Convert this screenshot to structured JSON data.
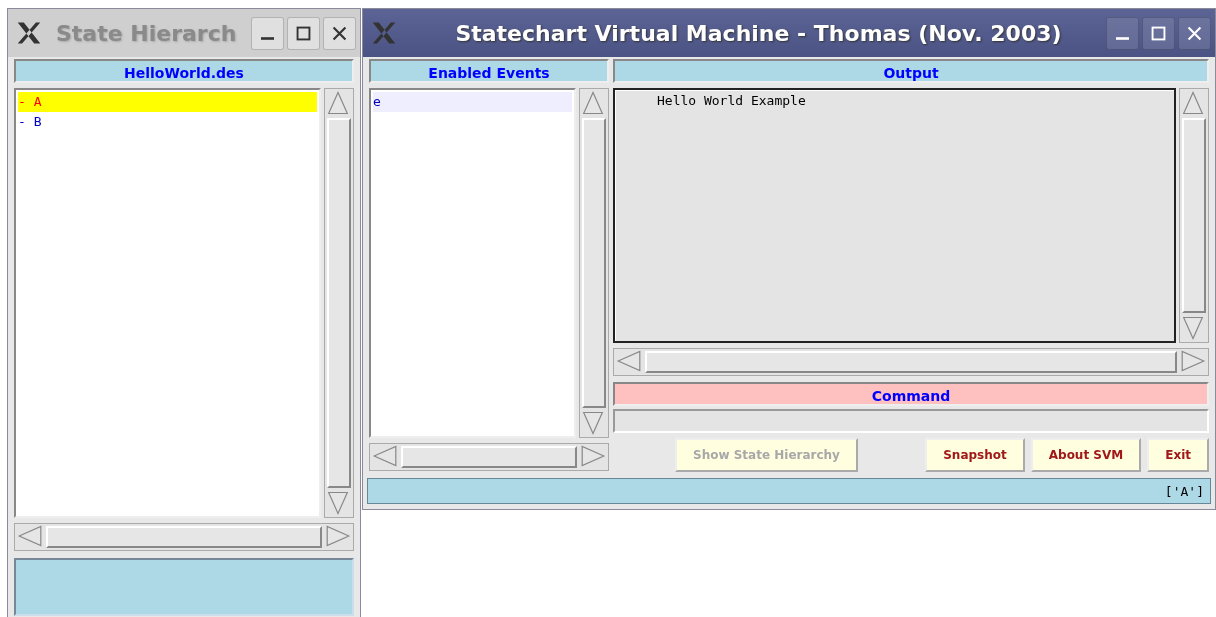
{
  "state_window": {
    "title": "State Hierarch",
    "active": false,
    "header": "HelloWorld.des",
    "states": [
      {
        "marker": "-",
        "name": "A",
        "selected": true
      },
      {
        "marker": "-",
        "name": "B",
        "selected": false
      }
    ]
  },
  "main_window": {
    "title": "Statechart Virtual Machine - Thomas (Nov. 2003)",
    "active": true,
    "events_header": "Enabled Events",
    "events": [
      {
        "name": "e",
        "selected": true
      }
    ],
    "output_header": "Output",
    "output_lines": [
      "Hello World Example"
    ],
    "command_header": "Command",
    "buttons": [
      {
        "label": "Show State Hierarchy",
        "disabled": true
      },
      {
        "label": "Snapshot",
        "disabled": false
      },
      {
        "label": "About SVM",
        "disabled": false
      },
      {
        "label": "Exit",
        "disabled": false
      }
    ],
    "status": "['A']"
  }
}
